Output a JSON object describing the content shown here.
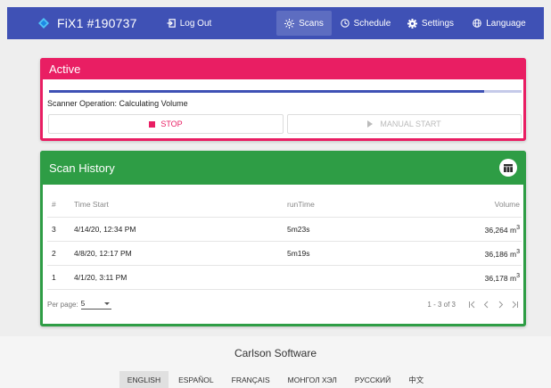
{
  "nav": {
    "brand": "FiX1 #190737",
    "logout": "Log Out",
    "scans": "Scans",
    "schedule": "Schedule",
    "settings": "Settings",
    "language": "Language",
    "colors": {
      "primary": "#3f51b5"
    }
  },
  "active": {
    "title": "Active",
    "progress": 0.92,
    "status": "Scanner Operation: Calculating Volume",
    "stop_label": "STOP",
    "manual_label": "MANUAL START",
    "colors": {
      "accent": "#e91e63"
    }
  },
  "history": {
    "title": "Scan History",
    "columns": [
      "#",
      "Time Start",
      "runTime",
      "Volume"
    ],
    "rows": [
      {
        "num": "3",
        "time": "4/14/20, 12:34 PM",
        "run": "5m23s",
        "vol": "36,264 m",
        "unit_sup": "3"
      },
      {
        "num": "2",
        "time": "4/8/20, 12:17 PM",
        "run": "5m19s",
        "vol": "36,186 m",
        "unit_sup": "3"
      },
      {
        "num": "1",
        "time": "4/1/20, 3:11 PM",
        "run": "",
        "vol": "36,178 m",
        "unit_sup": "3"
      }
    ],
    "per_page_label": "Per page:",
    "per_page_value": "5",
    "range": "1 - 3 of 3",
    "colors": {
      "accent": "#2e9d45"
    }
  },
  "footer": {
    "title": "Carlson Software",
    "languages": [
      "ENGLISH",
      "ESPAÑOL",
      "FRANÇAIS",
      "МОНГОЛ ХЭЛ",
      "РУССКИЙ",
      "中文"
    ],
    "active_language": "ENGLISH"
  }
}
